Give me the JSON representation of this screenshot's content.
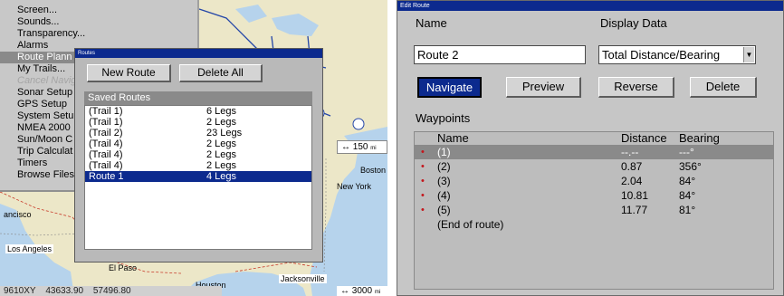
{
  "left_menu": {
    "items": [
      {
        "label": "Screen...",
        "state": "normal"
      },
      {
        "label": "Sounds...",
        "state": "normal"
      },
      {
        "label": "Transparency...",
        "state": "normal"
      },
      {
        "label": "Alarms",
        "state": "normal"
      },
      {
        "label": "Route Plann",
        "state": "selected"
      },
      {
        "label": "My Trails...",
        "state": "normal"
      },
      {
        "label": "Cancel Navig",
        "state": "disabled"
      },
      {
        "label": "Sonar Setup",
        "state": "normal"
      },
      {
        "label": "GPS Setup",
        "state": "normal"
      },
      {
        "label": "System Setu",
        "state": "normal"
      },
      {
        "label": "NMEA 2000",
        "state": "normal"
      },
      {
        "label": "Sun/Moon C",
        "state": "normal"
      },
      {
        "label": "Trip Calculat",
        "state": "normal"
      },
      {
        "label": "Timers",
        "state": "normal"
      },
      {
        "label": "Browse Files",
        "state": "normal"
      }
    ]
  },
  "map": {
    "labels": {
      "boston": "Boston",
      "new_york": "New York",
      "francisco": "ancisco",
      "los_angeles": "Los Angeles",
      "el_paso": "El Paso",
      "houston": "Houston",
      "jacksonville": "Jacksonville"
    },
    "scale_top": "150",
    "scale_top_unit": "mi",
    "scale_bottom": "3000",
    "scale_bottom_unit": "mi",
    "coords": [
      "9610XY",
      "43633.90",
      "57496.80"
    ]
  },
  "routes_dialog": {
    "title": "Routes",
    "new_route_label": "New Route",
    "delete_all_label": "Delete All",
    "saved_header": "Saved Routes",
    "rows": [
      {
        "name": "(Trail 1)",
        "legs": "6 Legs"
      },
      {
        "name": "(Trail 1)",
        "legs": "2 Legs"
      },
      {
        "name": "(Trail 2)",
        "legs": "23 Legs"
      },
      {
        "name": "(Trail 4)",
        "legs": "2 Legs"
      },
      {
        "name": "(Trail 4)",
        "legs": "2 Legs"
      },
      {
        "name": "(Trail 4)",
        "legs": "2 Legs"
      },
      {
        "name": "Route 1",
        "legs": "4 Legs",
        "selected": true
      }
    ]
  },
  "edit_route": {
    "title": "Edit Route",
    "name_label": "Name",
    "name_value": "Route 2",
    "display_label": "Display Data",
    "display_value": "Total Distance/Bearing",
    "buttons": {
      "navigate": "Navigate",
      "preview": "Preview",
      "reverse": "Reverse",
      "delete": "Delete"
    },
    "waypoints_label": "Waypoints",
    "columns": {
      "name": "Name",
      "distance": "Distance",
      "bearing": "Bearing"
    },
    "rows": [
      {
        "name": "(1)",
        "distance": "--.--",
        "bearing": "---°",
        "selected": true
      },
      {
        "name": "(2)",
        "distance": "0.87",
        "bearing": "356°"
      },
      {
        "name": "(3)",
        "distance": "2.04",
        "bearing": "84°"
      },
      {
        "name": "(4)",
        "distance": "10.81",
        "bearing": "84°"
      },
      {
        "name": "(5)",
        "distance": "11.77",
        "bearing": "81°"
      }
    ],
    "end_text": "(End of route)"
  },
  "colors": {
    "title_bar": "#0c2a8e",
    "selection_gray": "#8a8a8a",
    "waypoint_dot": "#c4161c"
  }
}
